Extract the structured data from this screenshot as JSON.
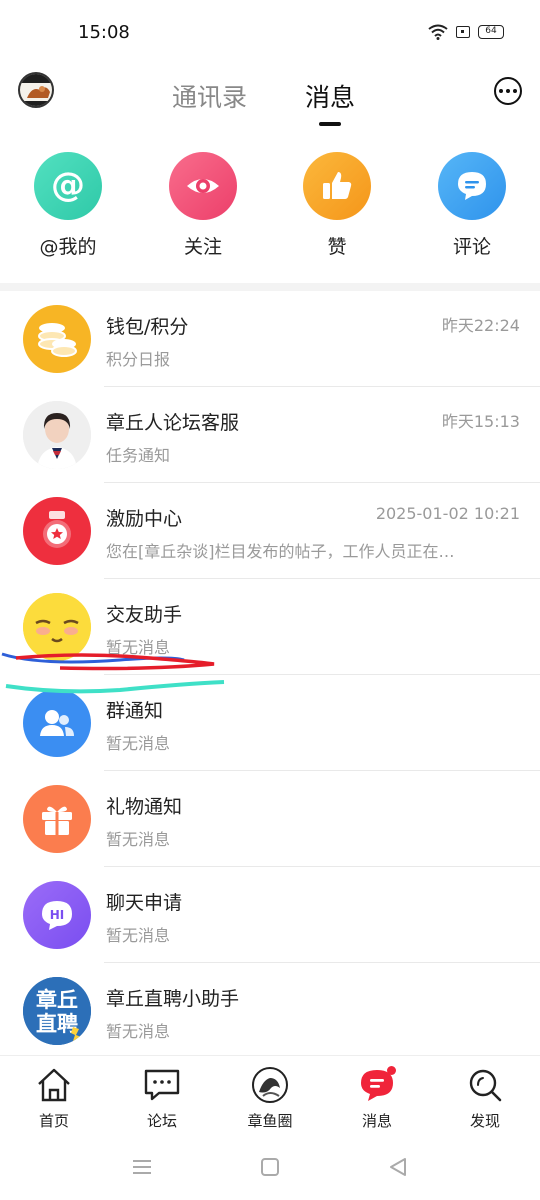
{
  "status": {
    "time": "15:08",
    "battery": "64"
  },
  "header": {
    "tabs": [
      {
        "label": "通讯录"
      },
      {
        "label": "消息"
      }
    ],
    "active_tab": "消息"
  },
  "quick_actions": [
    {
      "label": "@我的",
      "icon": "at-icon",
      "color": "#3ed6b4"
    },
    {
      "label": "关注",
      "icon": "eye-icon",
      "color": "#f0567a"
    },
    {
      "label": "赞",
      "icon": "thumbs-up-icon",
      "color": "#f7a325"
    },
    {
      "label": "评论",
      "icon": "comment-icon",
      "color": "#3ea3f2"
    }
  ],
  "messages": [
    {
      "title": "钱包/积分",
      "subtitle": "积分日报",
      "time": "昨天22:24",
      "icon": "coins-icon",
      "color": "#f7b525"
    },
    {
      "title": "章丘人论坛客服",
      "subtitle": "任务通知",
      "time": "昨天15:13",
      "icon": "service-agent-avatar",
      "color": "#e6e6e6"
    },
    {
      "title": "激励中心",
      "subtitle": "您在[章丘杂谈]栏目发布的帖子，工作人员正在…",
      "time": "2025-01-02 10:21",
      "icon": "reward-icon",
      "color": "#ee2f3e"
    },
    {
      "title": "交友助手",
      "subtitle": "暂无消息",
      "time": "",
      "icon": "shy-face-icon",
      "color": "#fbd93a"
    },
    {
      "title": "群通知",
      "subtitle": "暂无消息",
      "time": "",
      "icon": "group-icon",
      "color": "#3b8ef2"
    },
    {
      "title": "礼物通知",
      "subtitle": "暂无消息",
      "time": "",
      "icon": "gift-icon",
      "color": "#fb7d4e"
    },
    {
      "title": "聊天申请",
      "subtitle": "暂无消息",
      "time": "",
      "icon": "hi-bubble-icon",
      "color": "#8a5cf5"
    },
    {
      "title": "章丘直聘小助手",
      "subtitle": "暂无消息",
      "time": "",
      "icon": "recruit-logo",
      "color": "#2c6fb8",
      "logo_text": "章丘直聘"
    }
  ],
  "bottom_nav": [
    {
      "label": "首页",
      "icon": "home-icon"
    },
    {
      "label": "论坛",
      "icon": "forum-icon"
    },
    {
      "label": "章鱼圈",
      "icon": "octopus-icon"
    },
    {
      "label": "消息",
      "icon": "message-icon",
      "badge": true,
      "active": true
    },
    {
      "label": "发现",
      "icon": "discover-icon"
    }
  ],
  "accent": "#f0243a"
}
